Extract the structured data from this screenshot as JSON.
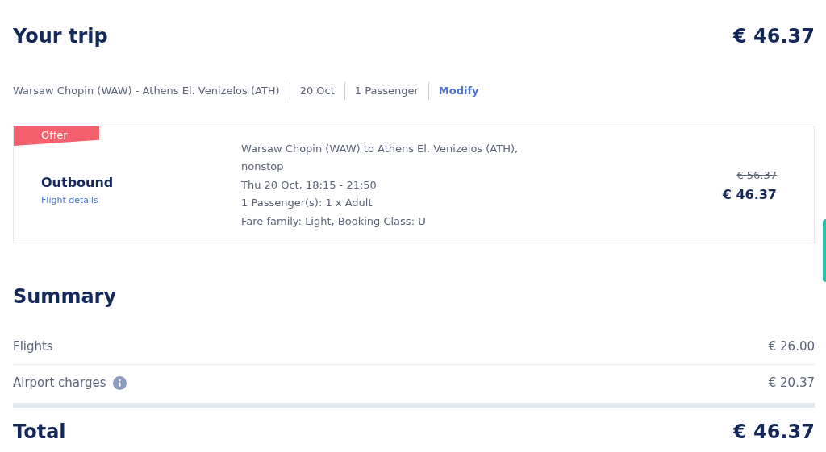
{
  "trip": {
    "title": "Your trip",
    "price": "€ 46.37"
  },
  "route_bar": {
    "items": [
      "Warsaw Chopin (WAW) - Athens El. Venizelos (ATH)",
      "20 Oct",
      "1 Passenger"
    ],
    "link": "Modify"
  },
  "flights": [
    {
      "badge": "Offer",
      "direction": "Outbound",
      "details_link": "Flight details",
      "lines": [
        "Warsaw Chopin (WAW) to Athens El. Venizelos (ATH), nonstop",
        "Thu 20 Oct, 18:15 - 21:50",
        "1 Passenger(s): 1 x Adult",
        "Fare family: Light, Booking Class: U"
      ],
      "old_price": "€ 56.37",
      "price": "€ 46.37"
    }
  ],
  "summary": {
    "title": "Summary",
    "rows": [
      {
        "label": "Flights",
        "info": false,
        "amount": "€ 26.00"
      },
      {
        "label": "Airport charges",
        "info": true,
        "amount": "€ 20.37"
      }
    ],
    "total": {
      "label": "Total",
      "amount": "€ 46.37"
    }
  }
}
